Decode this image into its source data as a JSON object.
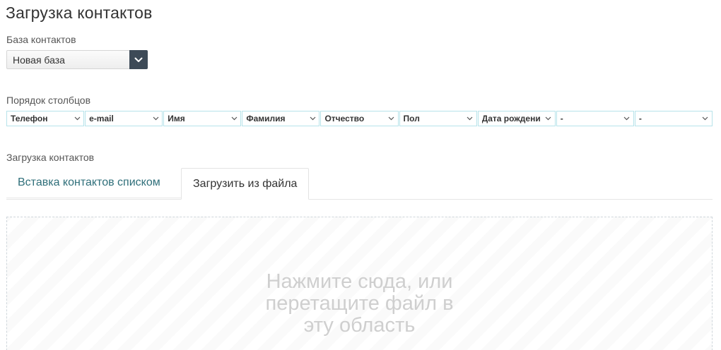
{
  "page": {
    "title": "Загрузка контактов"
  },
  "database": {
    "label": "База контактов",
    "selected": "Новая база",
    "toggle_icon": "chevron-down-icon"
  },
  "column_order": {
    "label": "Порядок столбцов",
    "columns": [
      "Телефон",
      "e-mail",
      "Имя",
      "Фамилия",
      "Отчество",
      "Пол",
      "Дата рождени",
      "-",
      "-"
    ]
  },
  "upload": {
    "label": "Загрузка контактов",
    "tabs": [
      {
        "label": "Вставка контактов списком",
        "active": false
      },
      {
        "label": "Загрузить из файла",
        "active": true
      }
    ],
    "dropzone_lines": [
      "Нажмите сюда, или",
      "перетащите файл в",
      "эту область"
    ]
  },
  "colors": {
    "tab_link": "#2f6f7a",
    "select_button": "#3d4a57",
    "column_border": "#b7e3ea",
    "dropzone_text": "#cfcfcf"
  }
}
